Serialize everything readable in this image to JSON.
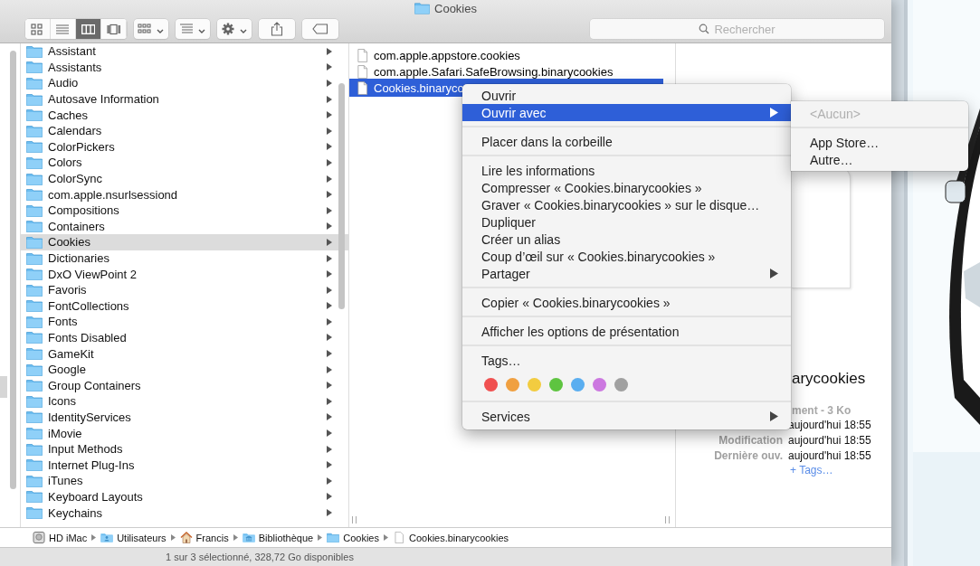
{
  "window": {
    "title": "Cookies"
  },
  "toolbar": {
    "view_buttons": [
      {
        "kind": "icons",
        "selected": false
      },
      {
        "kind": "list",
        "selected": false
      },
      {
        "kind": "columns",
        "selected": true
      },
      {
        "kind": "coverflow",
        "selected": false
      }
    ],
    "search": {
      "placeholder": "Rechercher"
    }
  },
  "folders": [
    {
      "name": "Assistant",
      "selected": false
    },
    {
      "name": "Assistants",
      "selected": false
    },
    {
      "name": "Audio",
      "selected": false
    },
    {
      "name": "Autosave Information",
      "selected": false
    },
    {
      "name": "Caches",
      "selected": false
    },
    {
      "name": "Calendars",
      "selected": false
    },
    {
      "name": "ColorPickers",
      "selected": false
    },
    {
      "name": "Colors",
      "selected": false
    },
    {
      "name": "ColorSync",
      "selected": false
    },
    {
      "name": "com.apple.nsurlsessiond",
      "selected": false
    },
    {
      "name": "Compositions",
      "selected": false
    },
    {
      "name": "Containers",
      "selected": false
    },
    {
      "name": "Cookies",
      "selected": true
    },
    {
      "name": "Dictionaries",
      "selected": false
    },
    {
      "name": "DxO ViewPoint 2",
      "selected": false
    },
    {
      "name": "Favoris",
      "selected": false
    },
    {
      "name": "FontCollections",
      "selected": false
    },
    {
      "name": "Fonts",
      "selected": false
    },
    {
      "name": "Fonts Disabled",
      "selected": false
    },
    {
      "name": "GameKit",
      "selected": false
    },
    {
      "name": "Google",
      "selected": false
    },
    {
      "name": "Group Containers",
      "selected": false
    },
    {
      "name": "Icons",
      "selected": false
    },
    {
      "name": "IdentityServices",
      "selected": false
    },
    {
      "name": "iMovie",
      "selected": false
    },
    {
      "name": "Input Methods",
      "selected": false
    },
    {
      "name": "Internet Plug-Ins",
      "selected": false
    },
    {
      "name": "iTunes",
      "selected": false
    },
    {
      "name": "Keyboard Layouts",
      "selected": false
    },
    {
      "name": "Keychains",
      "selected": false
    }
  ],
  "files": [
    {
      "name": "com.apple.appstore.cookies",
      "selected": false
    },
    {
      "name": "com.apple.Safari.SafeBrowsing.binarycookies",
      "selected": false
    },
    {
      "name": "Cookies.binaryco",
      "selected": true
    }
  ],
  "preview": {
    "title": "arycookies",
    "kind_size": "ment - 3 Ko",
    "dates": [
      {
        "value": "aujourd'hui 18:55"
      },
      {
        "label": "Modification",
        "value": "aujourd'hui 18:55"
      },
      {
        "label": "Dernière ouv.",
        "value": "aujourd'hui 18:55"
      }
    ],
    "tags_link": "+ Tags…"
  },
  "context_menu": {
    "groups": [
      [
        {
          "label": "Ouvrir",
          "submenu": false,
          "selected": false
        },
        {
          "label": "Ouvrir avec",
          "submenu": true,
          "selected": true
        }
      ],
      [
        {
          "label": "Placer dans la corbeille",
          "submenu": false,
          "selected": false
        }
      ],
      [
        {
          "label": "Lire les informations",
          "submenu": false,
          "selected": false
        },
        {
          "label": "Compresser « Cookies.binarycookies »",
          "submenu": false,
          "selected": false
        },
        {
          "label": "Graver « Cookies.binarycookies » sur le disque…",
          "submenu": false,
          "selected": false
        },
        {
          "label": "Dupliquer",
          "submenu": false,
          "selected": false
        },
        {
          "label": "Créer un alias",
          "submenu": false,
          "selected": false
        },
        {
          "label": "Coup d’œil sur « Cookies.binarycookies »",
          "submenu": false,
          "selected": false
        },
        {
          "label": "Partager",
          "submenu": true,
          "selected": false
        }
      ],
      [
        {
          "label": "Copier « Cookies.binarycookies »",
          "submenu": false,
          "selected": false
        }
      ],
      [
        {
          "label": "Afficher les options de présentation",
          "submenu": false,
          "selected": false
        }
      ],
      [
        {
          "label": "Tags…",
          "submenu": false,
          "selected": false
        }
      ]
    ],
    "tag_colors": [
      {
        "color": "#f05050"
      },
      {
        "color": "#f0a040"
      },
      {
        "color": "#f2cc40"
      },
      {
        "color": "#5ec440"
      },
      {
        "color": "#5aaef0"
      },
      {
        "color": "#cc78e0"
      },
      {
        "color": "#a0a0a0"
      }
    ],
    "last_group": [
      {
        "label": "Services",
        "submenu": true,
        "selected": false
      }
    ]
  },
  "submenu": {
    "groups": [
      [
        {
          "label": "<Aucun>",
          "disabled": true
        }
      ],
      [
        {
          "label": "App Store…",
          "disabled": false
        },
        {
          "label": "Autre…",
          "disabled": false
        }
      ]
    ]
  },
  "path_bar": [
    {
      "kind": "disk",
      "label": "HD iMac"
    },
    {
      "kind": "users",
      "label": "Utilisateurs"
    },
    {
      "kind": "home",
      "label": "Francis"
    },
    {
      "kind": "library",
      "label": "Bibliothèque"
    },
    {
      "kind": "folder",
      "label": "Cookies"
    },
    {
      "kind": "file",
      "label": "Cookies.binarycookies"
    }
  ],
  "status_bar": "1 sur 3 sélectionné, 328,72 Go disponibles"
}
